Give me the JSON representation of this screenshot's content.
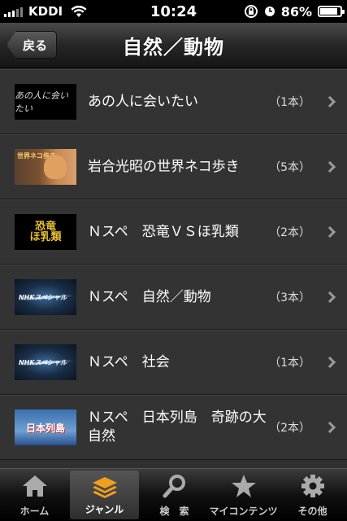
{
  "status": {
    "carrier": "KDDI",
    "time": "10:24",
    "battery_text": "86%",
    "battery_level": 0.86
  },
  "nav": {
    "back_label": "戻る",
    "title": "自然／動物"
  },
  "list": [
    {
      "title": "あの人に会いたい",
      "count": "（1本）",
      "thumb_text": "あの人に会いたい"
    },
    {
      "title": "岩合光昭の世界ネコ歩き",
      "count": "（5本）",
      "thumb_text": "世界ネコ歩き"
    },
    {
      "title": "Ｎスペ　恐竜ＶＳほ乳類",
      "count": "（2本）",
      "thumb_text": "恐竜",
      "thumb_text2": "ほ乳類"
    },
    {
      "title": "Ｎスペ　自然／動物",
      "count": "（3本）",
      "thumb_text": "NHKスペシャル"
    },
    {
      "title": "Ｎスペ　社会",
      "count": "（1本）",
      "thumb_text": "NHKスペシャル"
    },
    {
      "title": "Ｎスペ　日本列島　奇跡の大自然",
      "count": "（2本）",
      "thumb_text": "日本列島"
    }
  ],
  "tabs": [
    {
      "label": "ホーム",
      "icon": "home-icon",
      "selected": false
    },
    {
      "label": "ジャンル",
      "icon": "layers-icon",
      "selected": true
    },
    {
      "label": "検　索",
      "icon": "search-icon",
      "selected": false
    },
    {
      "label": "マイコンテンツ",
      "icon": "star-icon",
      "selected": false
    },
    {
      "label": "その他",
      "icon": "gear-icon",
      "selected": false
    }
  ],
  "colors": {
    "accent": "#f0a020",
    "background": "#333333"
  }
}
